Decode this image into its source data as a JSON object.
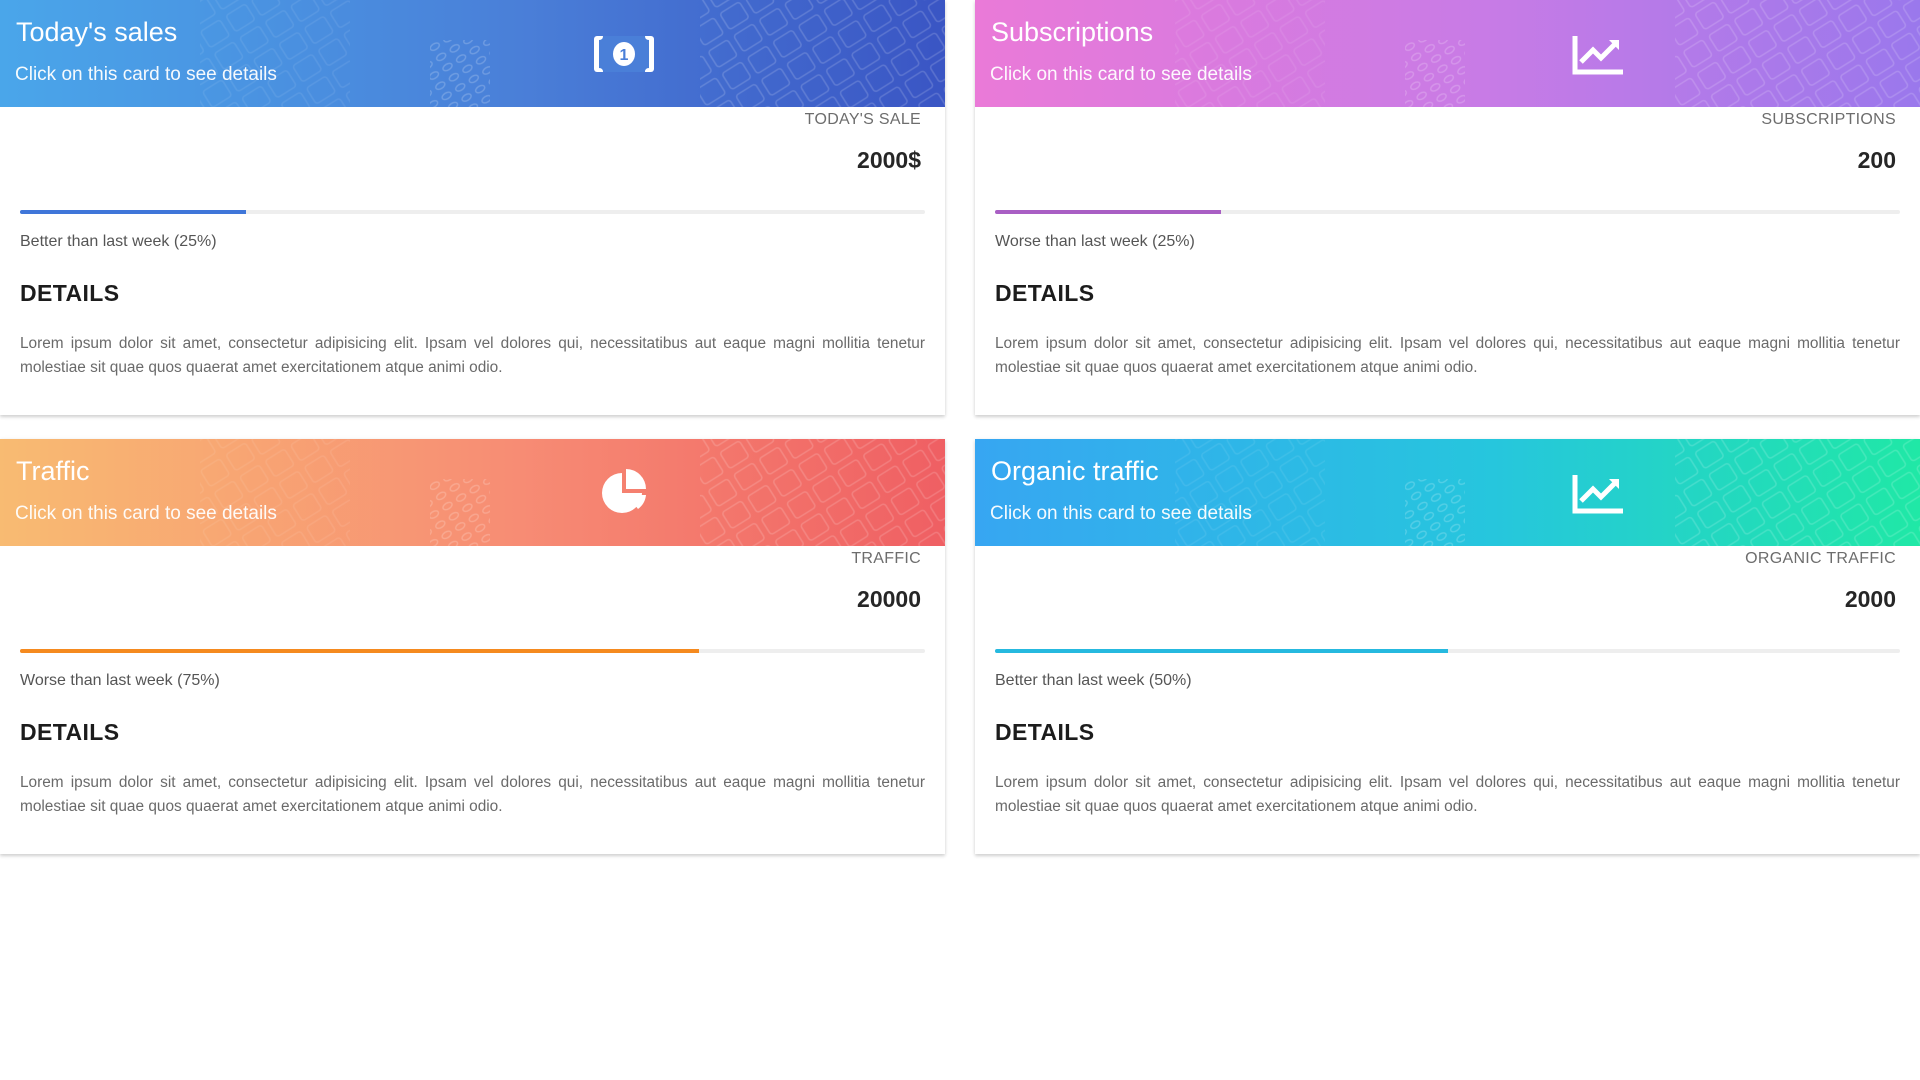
{
  "cards": [
    {
      "title": "Today's sales",
      "subtitle": "Click on this card to see details",
      "icon": "money-bill-icon",
      "stat_label": "TODAY'S SALE",
      "stat_value": "2000$",
      "progress": 0.25,
      "bar_color": "#3f76d9",
      "comparison": "Better than last week (25%)",
      "details_heading": "DETAILS",
      "details_text": "Lorem ipsum dolor sit amet, consectetur adipisicing elit. Ipsam vel dolores qui, necessitatibus aut eaque magni mollitia tenetur molestiae sit quae quos quaerat amet exercitationem atque animi odio."
    },
    {
      "title": "Subscriptions",
      "subtitle": "Click on this card to see details",
      "icon": "area-chart-icon",
      "stat_label": "SUBSCRIPTIONS",
      "stat_value": "200",
      "progress": 0.25,
      "bar_color": "#a95fc4",
      "comparison": "Worse than last week (25%)",
      "details_heading": "DETAILS",
      "details_text": "Lorem ipsum dolor sit amet, consectetur adipisicing elit. Ipsam vel dolores qui, necessitatibus aut eaque magni mollitia tenetur molestiae sit quae quos quaerat amet exercitationem atque animi odio."
    },
    {
      "title": "Traffic",
      "subtitle": "Click on this card to see details",
      "icon": "pie-chart-icon",
      "stat_label": "TRAFFIC",
      "stat_value": "20000",
      "progress": 0.75,
      "bar_color": "#f58a1f",
      "comparison": "Worse than last week (75%)",
      "details_heading": "DETAILS",
      "details_text": "Lorem ipsum dolor sit amet, consectetur adipisicing elit. Ipsam vel dolores qui, necessitatibus aut eaque magni mollitia tenetur molestiae sit quae quos quaerat amet exercitationem atque animi odio."
    },
    {
      "title": "Organic traffic",
      "subtitle": "Click on this card to see details",
      "icon": "area-chart-icon",
      "stat_label": "ORGANIC TRAFFIC",
      "stat_value": "2000",
      "progress": 0.5,
      "bar_color": "#26b9df",
      "comparison": "Better than last week (50%)",
      "details_heading": "DETAILS",
      "details_text": "Lorem ipsum dolor sit amet, consectetur adipisicing elit. Ipsam vel dolores qui, necessitatibus aut eaque magni mollitia tenetur molestiae sit quae quos quaerat amet exercitationem atque animi odio."
    }
  ]
}
